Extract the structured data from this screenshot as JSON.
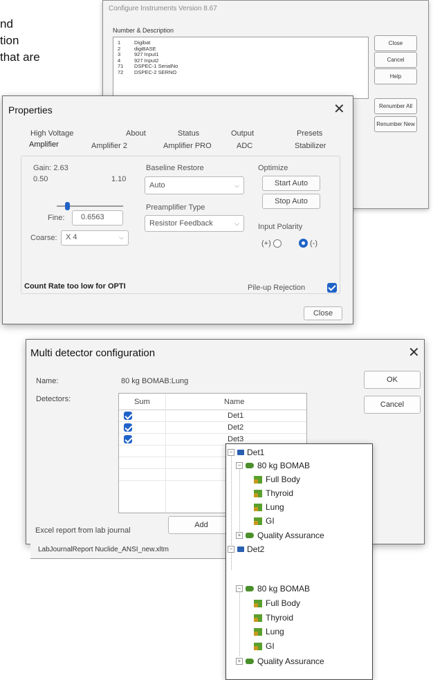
{
  "background_text": [
    "nd",
    "tion",
    "that are"
  ],
  "configure_instruments": {
    "title": "Configure Instruments Version 8.67",
    "list_header": "Number  &  Description",
    "rows": [
      {
        "num": "1",
        "desc": "Digibat"
      },
      {
        "num": "2",
        "desc": "digiBASE"
      },
      {
        "num": "3",
        "desc": "927 Input1"
      },
      {
        "num": "4",
        "desc": "927 Input2"
      },
      {
        "num": "71",
        "desc": "DSPEC-1 SerialNo"
      },
      {
        "num": "72",
        "desc": "DSPEC-2 SERNO"
      }
    ],
    "buttons": [
      "Close",
      "Cancel",
      "Help",
      "Renumber All",
      "Renumber New"
    ]
  },
  "properties": {
    "title": "Properties",
    "tabs_row1": [
      "High Voltage",
      "About",
      "Status",
      "Output",
      "Presets"
    ],
    "tabs_row2": [
      "Amplifier",
      "Amplifier 2",
      "Amplifier PRO",
      "ADC",
      "Stabilizer"
    ],
    "gain_label": "Gain: 2.63",
    "gain_min": "0.50",
    "gain_max": "1.10",
    "fine_slider_fraction": 0.12,
    "fine_label": "Fine:",
    "fine_value": "0.6563",
    "coarse_label": "Coarse:",
    "coarse_value": "X 4",
    "baseline_label": "Baseline Restore",
    "baseline_value": "Auto",
    "preamp_label": "Preamplifier Type",
    "preamp_value": "Resistor Feedback",
    "optimize_label": "Optimize",
    "start_auto": "Start Auto",
    "stop_auto": "Stop Auto",
    "polarity_label": "Input Polarity",
    "polarity_pos": "(+)",
    "polarity_neg": "(-)",
    "polarity_selected": "negative",
    "status_message": "Count Rate too low for OPTI",
    "pileup_label": "Pile-up Rejection",
    "pileup_checked": true,
    "close": "Close",
    "accent": "#1f63c8"
  },
  "multi_detector": {
    "title": "Multi detector configuration",
    "name_label": "Name:",
    "name_value": "80 kg BOMAB:Lung",
    "detectors_label": "Detectors:",
    "col_sum": "Sum",
    "col_name": "Name",
    "rows": [
      {
        "sum": true,
        "name": "Det1"
      },
      {
        "sum": true,
        "name": "Det2"
      },
      {
        "sum": true,
        "name": "Det3"
      }
    ],
    "add_button": "Add",
    "ok_button": "OK",
    "cancel_button": "Cancel",
    "excel_label": "Excel report from lab journal",
    "excel_value": "LabJournalReport Nuclide_ANSI_new.xltm"
  },
  "tree": {
    "det1": "Det1",
    "det1_group": "80 kg BOMAB",
    "det1_items": [
      "Full Body",
      "Thyroid",
      "Lung",
      "GI"
    ],
    "det1_qa": "Quality Assurance",
    "det2": "Det2",
    "det2_group": "80 kg BOMAB",
    "det2_items": [
      "Full Body",
      "Thyroid",
      "Lung",
      "GI"
    ],
    "det2_qa": "Quality Assurance"
  }
}
